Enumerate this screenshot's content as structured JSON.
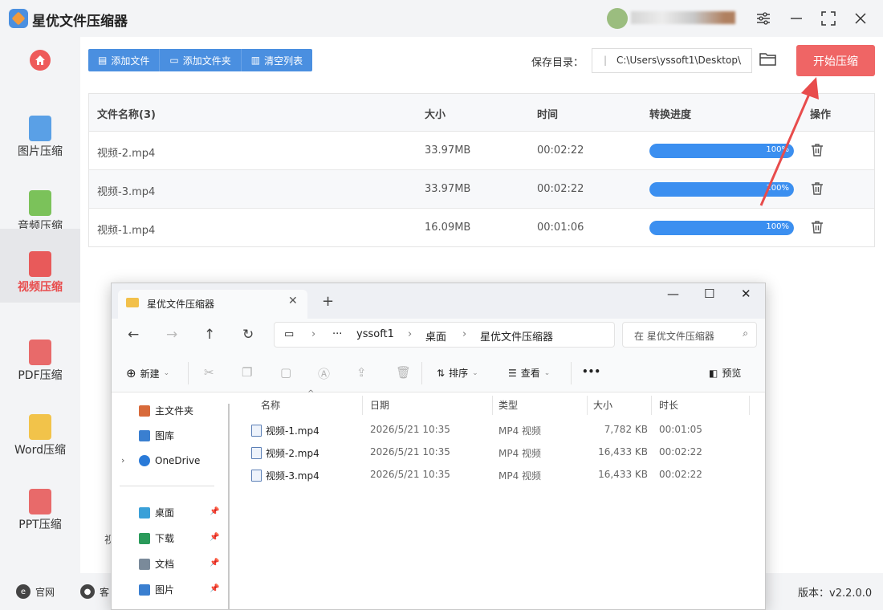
{
  "app": {
    "title": "星优文件压缩器",
    "version": "版本：v2.2.0.0"
  },
  "sidebar": {
    "items": [
      {
        "label": "图片压缩",
        "color": "#5aa0e6",
        "active": false
      },
      {
        "label": "音频压缩",
        "color": "#7bc25a",
        "active": false
      },
      {
        "label": "视频压缩",
        "color": "#e85a5a",
        "active": true
      },
      {
        "label": "PDF压缩",
        "color": "#e86a6a",
        "active": false
      },
      {
        "label": "Word压缩",
        "color": "#f2c34a",
        "active": false
      },
      {
        "label": "PPT压缩",
        "color": "#e86a6a",
        "active": false
      }
    ]
  },
  "toolbar": {
    "add_file": "添加文件",
    "add_folder": "添加文件夹",
    "clear_list": "清空列表"
  },
  "save": {
    "label": "保存目录：",
    "path": "C:\\Users\\yssoft1\\Desktop\\",
    "start": "开始压缩"
  },
  "table": {
    "headers": [
      "文件名称(3)",
      "大小",
      "时间",
      "转换进度",
      "操作"
    ],
    "rows": [
      {
        "name": "视频-2.mp4",
        "size": "33.97MB",
        "time": "00:02:22",
        "progress": 100,
        "progress_text": "100%"
      },
      {
        "name": "视频-3.mp4",
        "size": "33.97MB",
        "time": "00:02:22",
        "progress": 100,
        "progress_text": "100%"
      },
      {
        "name": "视频-1.mp4",
        "size": "16.09MB",
        "time": "00:01:06",
        "progress": 100,
        "progress_text": "100%"
      }
    ]
  },
  "footer": {
    "website": "官网",
    "service": "客",
    "cut_text": "视"
  },
  "explorer": {
    "tab_title": "星优文件压缩器",
    "breadcrumb": [
      "yssoft1",
      "桌面",
      "星优文件压缩器"
    ],
    "search_placeholder": "在 星优文件压缩器",
    "commands": {
      "new": "新建",
      "sort": "排序",
      "view": "查看",
      "more": "•••",
      "preview": "预览"
    },
    "nav_items": [
      {
        "label": "主文件夹",
        "icon": "home-icon",
        "color": "#d86a3a"
      },
      {
        "label": "图库",
        "icon": "gallery-icon",
        "color": "#3a7fd0"
      },
      {
        "label": "OneDrive",
        "icon": "cloud-icon",
        "color": "#2a7ad8"
      },
      {
        "label": "桌面",
        "icon": "desktop-icon",
        "color": "#3aa0d8"
      },
      {
        "label": "下载",
        "icon": "download-icon",
        "color": "#2a9a5a"
      },
      {
        "label": "文档",
        "icon": "document-icon",
        "color": "#7a8a9a"
      },
      {
        "label": "图片",
        "icon": "picture-icon",
        "color": "#3a7fd0"
      }
    ],
    "columns": [
      "名称",
      "日期",
      "类型",
      "大小",
      "时长"
    ],
    "files": [
      {
        "name": "视频-1.mp4",
        "date": "2026/5/21 10:35",
        "type": "MP4 视频",
        "size": "7,782 KB",
        "duration": "00:01:05"
      },
      {
        "name": "视频-2.mp4",
        "date": "2026/5/21 10:35",
        "type": "MP4 视频",
        "size": "16,433 KB",
        "duration": "00:02:22"
      },
      {
        "name": "视频-3.mp4",
        "date": "2026/5/21 10:35",
        "type": "MP4 视频",
        "size": "16,433 KB",
        "duration": "00:02:22"
      }
    ]
  },
  "colors": {
    "accent": "#4a8fe0",
    "start": "#ef6565",
    "progress": "#3b8ff0",
    "arrow": "#e84c4c"
  }
}
